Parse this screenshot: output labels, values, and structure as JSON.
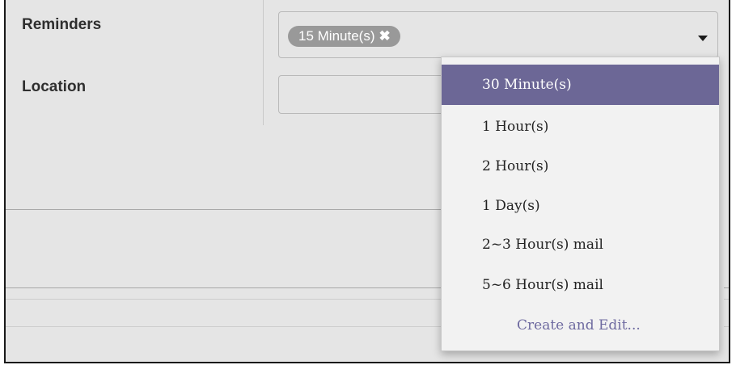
{
  "form": {
    "reminders_label": "Reminders",
    "location_label": "Location",
    "selected_tag": "15 Minute(s)",
    "tag_remove_glyph": "✖",
    "location_value": ""
  },
  "dropdown": {
    "options": [
      {
        "label": "30 Minute(s)",
        "highlighted": true
      },
      {
        "label": "1 Hour(s)"
      },
      {
        "label": "2 Hour(s)"
      },
      {
        "label": "1 Day(s)"
      },
      {
        "label": "2~3 Hour(s) mail"
      },
      {
        "label": "5~6 Hour(s) mail"
      }
    ],
    "create_label": "Create and Edit..."
  },
  "colors": {
    "highlight": "#6c6796",
    "tag_bg": "#999999",
    "link": "#6e6aa0"
  },
  "icons": [
    "close-icon",
    "chevron-down-icon"
  ]
}
